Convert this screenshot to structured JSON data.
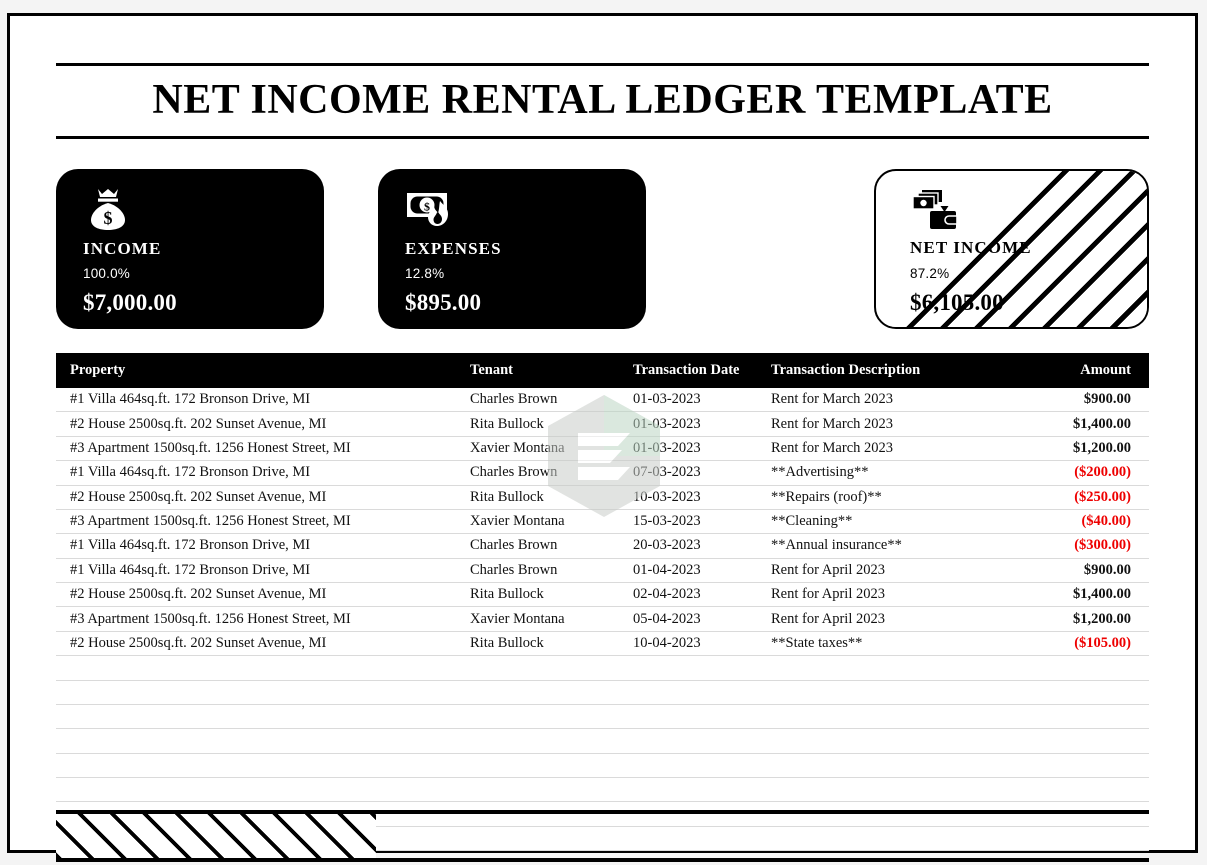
{
  "document": {
    "title": "NET INCOME RENTAL LEDGER TEMPLATE"
  },
  "summary_cards": [
    {
      "icon": "money-bag-icon",
      "label": "INCOME",
      "percent": "100.0%",
      "amount": "$7,000.00",
      "style": "dark"
    },
    {
      "icon": "burning-money-icon",
      "label": "EXPENSES",
      "percent": "12.8%",
      "amount": "$895.00",
      "style": "dark"
    },
    {
      "icon": "money-to-wallet-icon",
      "label": "NET INCOME",
      "percent": "87.2%",
      "amount": "$6,105.00",
      "style": "light-striped"
    }
  ],
  "ledger": {
    "columns": [
      "Property",
      "Tenant",
      "Transaction Date",
      "Transaction Description",
      "Amount"
    ],
    "rows": [
      {
        "property": "#1 Villa 464sq.ft. 172 Bronson Drive, MI",
        "tenant": "Charles Brown",
        "date": "01-03-2023",
        "description": "Rent for March 2023",
        "amount": "$900.00",
        "negative": false
      },
      {
        "property": "#2 House 2500sq.ft. 202 Sunset Avenue, MI",
        "tenant": "Rita Bullock",
        "date": "01-03-2023",
        "description": "Rent for March 2023",
        "amount": "$1,400.00",
        "negative": false
      },
      {
        "property": "#3 Apartment 1500sq.ft. 1256 Honest Street, MI",
        "tenant": "Xavier Montana",
        "date": "01-03-2023",
        "description": "Rent for March 2023",
        "amount": "$1,200.00",
        "negative": false
      },
      {
        "property": "#1 Villa 464sq.ft. 172 Bronson Drive, MI",
        "tenant": "Charles Brown",
        "date": "07-03-2023",
        "description": "**Advertising**",
        "amount": "($200.00)",
        "negative": true
      },
      {
        "property": "#2 House 2500sq.ft. 202 Sunset Avenue, MI",
        "tenant": "Rita Bullock",
        "date": "10-03-2023",
        "description": "**Repairs (roof)**",
        "amount": "($250.00)",
        "negative": true
      },
      {
        "property": "#3 Apartment 1500sq.ft. 1256 Honest Street, MI",
        "tenant": "Xavier Montana",
        "date": "15-03-2023",
        "description": "**Cleaning**",
        "amount": "($40.00)",
        "negative": true
      },
      {
        "property": "#1 Villa 464sq.ft. 172 Bronson Drive, MI",
        "tenant": "Charles Brown",
        "date": "20-03-2023",
        "description": "**Annual insurance**",
        "amount": "($300.00)",
        "negative": true
      },
      {
        "property": "#1 Villa 464sq.ft. 172 Bronson Drive, MI",
        "tenant": "Charles Brown",
        "date": "01-04-2023",
        "description": "Rent for April 2023",
        "amount": "$900.00",
        "negative": false
      },
      {
        "property": "#2 House 2500sq.ft. 202 Sunset Avenue, MI",
        "tenant": "Rita Bullock",
        "date": "02-04-2023",
        "description": "Rent for April 2023",
        "amount": "$1,400.00",
        "negative": false
      },
      {
        "property": "#3 Apartment 1500sq.ft. 1256 Honest Street, MI",
        "tenant": "Xavier Montana",
        "date": "05-04-2023",
        "description": "Rent for April 2023",
        "amount": "$1,200.00",
        "negative": false
      },
      {
        "property": "#2 House 2500sq.ft. 202 Sunset Avenue, MI",
        "tenant": "Rita Bullock",
        "date": "10-04-2023",
        "description": "**State taxes**",
        "amount": "($105.00)",
        "negative": true
      }
    ],
    "empty_row_count": 8
  },
  "colors": {
    "negative_amount": "#ee0000",
    "header_background": "#000000",
    "header_text": "#ffffff",
    "row_divider": "#dadada",
    "watermark_gray": "#c9cdc9",
    "watermark_green": "#b9d4c2"
  }
}
